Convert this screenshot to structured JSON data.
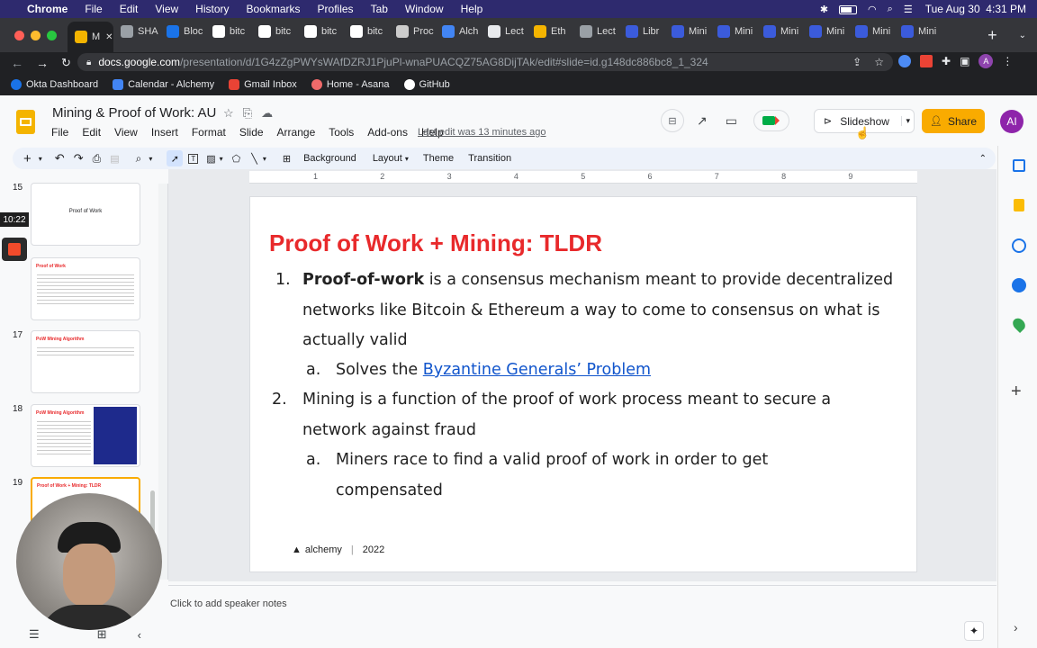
{
  "macos": {
    "apple": "",
    "app": "Chrome",
    "menus": [
      "File",
      "Edit",
      "View",
      "History",
      "Bookmarks",
      "Profiles",
      "Tab",
      "Window",
      "Help"
    ],
    "datetime": "Tue Aug 30  4:31 PM"
  },
  "tabs": [
    {
      "label": "M",
      "color": "#f4b400"
    },
    {
      "label": "SHA",
      "color": "#9aa0a6"
    },
    {
      "label": "Bloc",
      "color": "#1a73e8"
    },
    {
      "label": "bitc",
      "color": "#ffffff"
    },
    {
      "label": "bitc",
      "color": "#ffffff"
    },
    {
      "label": "bitc",
      "color": "#ffffff"
    },
    {
      "label": "bitc",
      "color": "#ffffff"
    },
    {
      "label": "Proc",
      "color": "#cccccc"
    },
    {
      "label": "Alch",
      "color": "#4285f4"
    },
    {
      "label": "Lect",
      "color": "#e8eaed"
    },
    {
      "label": "Eth",
      "color": "#f4b400"
    },
    {
      "label": "Lect",
      "color": "#9aa0a6"
    },
    {
      "label": "Libr",
      "color": "#3b5bdb"
    },
    {
      "label": "Mini",
      "color": "#3b5bdb"
    },
    {
      "label": "Mini",
      "color": "#3b5bdb"
    },
    {
      "label": "Mini",
      "color": "#3b5bdb"
    },
    {
      "label": "Mini",
      "color": "#3b5bdb"
    },
    {
      "label": "Mini",
      "color": "#3b5bdb"
    },
    {
      "label": "Mini",
      "color": "#3b5bdb"
    }
  ],
  "address": {
    "domain": "docs.google.com",
    "path": "/presentation/d/1G4zZgPWYsWAfDZRJ1PjuPl-wnaPUACQZ75AG8DijTAk/edit#slide=id.g148dc886bc8_1_324"
  },
  "bookmarks": [
    {
      "label": "Okta Dashboard",
      "color": "#1a73e8"
    },
    {
      "label": "Calendar - Alchemy",
      "color": "#4285f4"
    },
    {
      "label": "Gmail Inbox",
      "color": "#ea4335"
    },
    {
      "label": "Home - Asana",
      "color": "#f06a6a"
    },
    {
      "label": "GitHub",
      "color": "#ffffff"
    }
  ],
  "doc": {
    "title": "Mining & Proof of Work: AU",
    "menu": [
      "File",
      "Edit",
      "View",
      "Insert",
      "Format",
      "Slide",
      "Arrange",
      "Tools",
      "Add-ons",
      "Help"
    ],
    "last_edit": "Last edit was 13 minutes ago",
    "slideshow": "Slideshow",
    "share": "Share",
    "avatar": "AI"
  },
  "toolbar": {
    "background": "Background",
    "layout": "Layout",
    "theme": "Theme",
    "transition": "Transition"
  },
  "ruler": [
    "1",
    "2",
    "3",
    "4",
    "5",
    "6",
    "7",
    "8",
    "9"
  ],
  "filmstrip": [
    {
      "num": "15",
      "title": "Proof of Work"
    },
    {
      "num": "16",
      "title": "Proof of Work"
    },
    {
      "num": "17",
      "title": "PoW Mining Algorithm"
    },
    {
      "num": "18",
      "title": "PoW Mining Algorithm"
    },
    {
      "num": "19",
      "title": "Proof of Work + Mining: TLDR"
    }
  ],
  "recorder": {
    "timer": "10:22"
  },
  "slide": {
    "title": "Proof of Work + Mining: TLDR",
    "items": [
      {
        "marker": "1.",
        "bold": "Proof-of-work",
        "text": " is a consensus mechanism meant to provide decentralized networks like Bitcoin & Ethereum a way to come to consensus on what is actually valid"
      },
      {
        "marker": "a.",
        "text": "Solves the ",
        "link": "Byzantine Generals’ Problem"
      },
      {
        "marker": "2.",
        "text": "Mining is a function of the proof of work process meant to secure a network against fraud"
      },
      {
        "marker": "a.",
        "text": "Miners race to find a valid proof of work in order to get compensated"
      }
    ],
    "footer_brand": "alchemy",
    "footer_year": "2022"
  },
  "notes": {
    "placeholder": "Click to add speaker notes"
  },
  "colors": {
    "accent_red": "#e8292b",
    "share_yellow": "#f9ab00",
    "link_blue": "#1155cc"
  }
}
